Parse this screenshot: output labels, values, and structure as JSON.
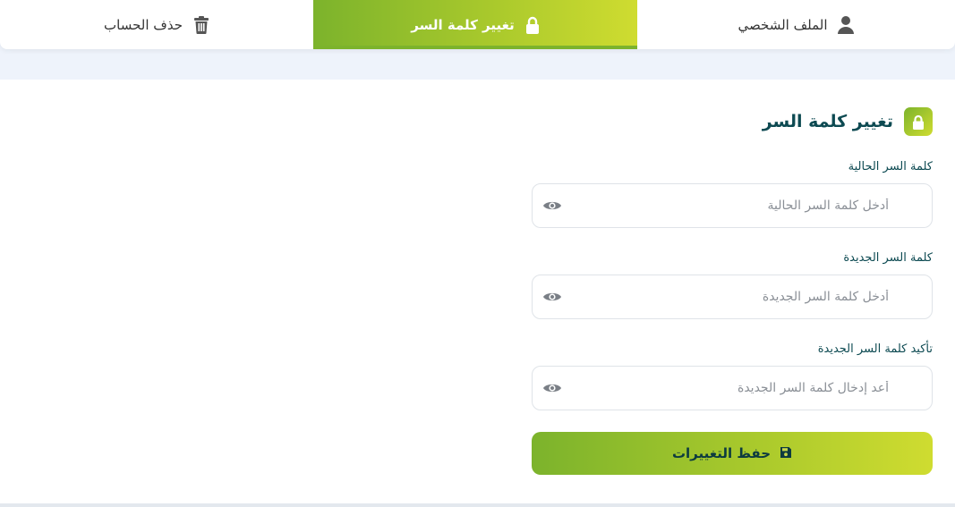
{
  "tabs": {
    "delete_account": "حذف الحساب",
    "change_password": "تغيير كلمة السر",
    "profile": "الملف الشخصي"
  },
  "form": {
    "title": "تغيير كلمة السر",
    "current": {
      "label": "كلمة السر الحالية",
      "placeholder": "أدخل كلمة السر الحالية",
      "value": ""
    },
    "new": {
      "label": "كلمة السر الجديدة",
      "placeholder": "أدخل كلمة السر الجديدة",
      "value": ""
    },
    "confirm": {
      "label": "تأكيد كلمة السر الجديدة",
      "placeholder": "أعد إدخال كلمة السر الجديدة",
      "value": ""
    },
    "save_label": "حفظ التغييرات"
  },
  "icons": {
    "delete_tab": "trash-icon",
    "password_tab": "lock-icon",
    "profile_tab": "user-icon",
    "heading": "lock-icon",
    "toggle": "eye-icon",
    "save": "floppy-disk-icon"
  },
  "colors": {
    "accent_start": "#7cb32c",
    "accent_end": "#cfdc30",
    "heading_text": "#0d4a52",
    "page_background": "#eef3fb"
  }
}
